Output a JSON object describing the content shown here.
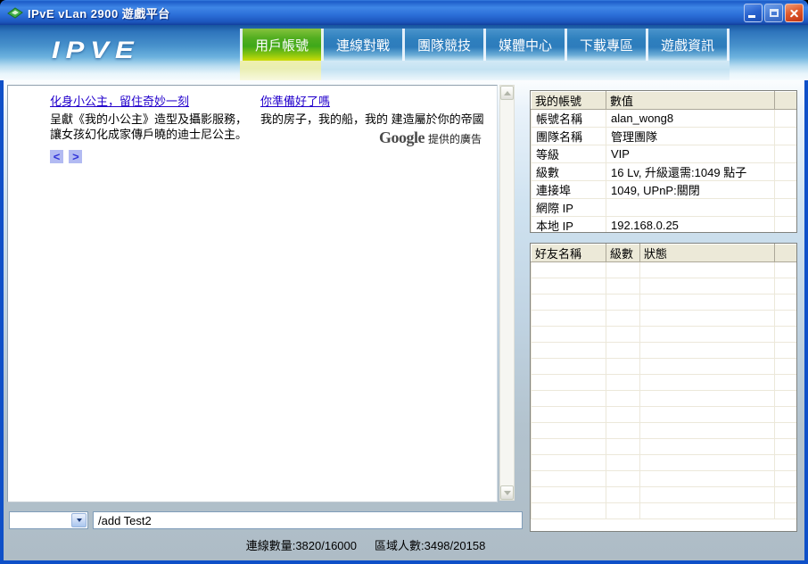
{
  "window": {
    "title": "IPvE vLan 2900 遊戲平台"
  },
  "logo": "IPVE",
  "nav": {
    "tabs": [
      {
        "label": "用戶帳號",
        "selected": true
      },
      {
        "label": "連線對戰",
        "selected": false
      },
      {
        "label": "團隊競技",
        "selected": false
      },
      {
        "label": "媒體中心",
        "selected": false
      },
      {
        "label": "下載專區",
        "selected": false
      },
      {
        "label": "遊戲資訊",
        "selected": false
      }
    ]
  },
  "ads": {
    "ad1": {
      "title": "化身小公主，留住奇妙一刻",
      "body": "呈獻《我的小公主》造型及攝影服務， 讓女孩幻化成家傳戶曉的迪士尼公主。"
    },
    "ad2": {
      "title": "你準備好了嗎",
      "body": "我的房子，我的船，我的 建造屬於你的帝國"
    },
    "pager_prev": "<",
    "pager_next": ">",
    "attribution_logo": "Google",
    "attribution_text": "提供的廣告"
  },
  "account_table": {
    "headers": [
      "我的帳號",
      "數值"
    ],
    "rows": [
      [
        "帳號名稱",
        "alan_wong8"
      ],
      [
        "團隊名稱",
        "管理團隊"
      ],
      [
        "等級",
        "VIP"
      ],
      [
        "級數",
        "16 Lv, 升級還需:1049 點子"
      ],
      [
        "連接埠",
        "1049, UPnP:關閉"
      ],
      [
        "網際 IP",
        ""
      ],
      [
        "本地 IP",
        "192.168.0.25"
      ]
    ]
  },
  "friends_table": {
    "headers": [
      "好友名稱",
      "級數",
      "狀態"
    ],
    "rows": []
  },
  "bottom": {
    "combo_value": "",
    "command_input_value": "/add Test2"
  },
  "status_bar": {
    "connections": "連線數量:3820/16000",
    "local_users": "區域人數:3498/20158"
  },
  "colors": {
    "titlebar_blue": "#2b6ed8",
    "selected_tab_green": "#4aac1e",
    "link_blue": "#2200cc",
    "header_beige": "#ece9d8",
    "status_gray": "#aebcc6",
    "window_border_blue": "#0f50c8"
  }
}
